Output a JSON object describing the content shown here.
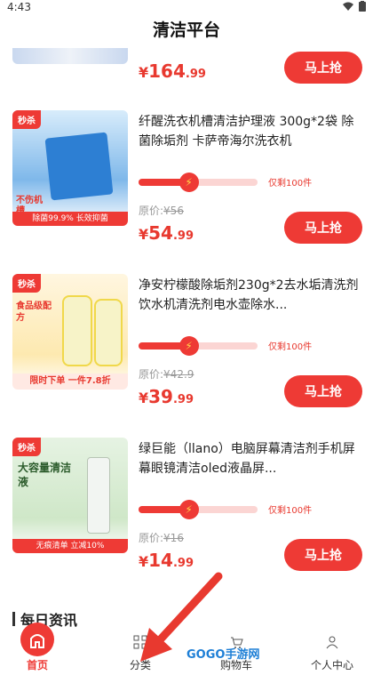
{
  "status_bar": {
    "time": "4:43"
  },
  "header": {
    "title": "清洁平台"
  },
  "top_item": {
    "price_yen": "¥",
    "price_int": "164",
    "price_dec": ".99",
    "buy_label": "马上抢"
  },
  "products": [
    {
      "tag": "秒杀",
      "title": "纤醒洗衣机槽清洁护理液 300g*2袋 除菌除垢剂 卡萨帝海尔洗衣机",
      "stock_text": "仅剩100件",
      "orig_label": "原价:",
      "orig_price": "¥56",
      "price_yen": "¥",
      "price_int": "54",
      "price_dec": ".99",
      "buy_label": "马上抢",
      "image_text_1": "不伤机槽",
      "image_text_2": "除菌99.9% 长效抑菌",
      "progress": 0.4
    },
    {
      "tag": "秒杀",
      "title": "净安柠檬酸除垢剂230g*2去水垢清洗剂饮水机清洗剂电水壶除水...",
      "stock_text": "仅剩100件",
      "orig_label": "原价:",
      "orig_price": "¥42.9",
      "price_yen": "¥",
      "price_int": "39",
      "price_dec": ".99",
      "buy_label": "马上抢",
      "image_text_1": "食品级配方",
      "image_text_2": "限时下单 一件7.8折",
      "progress": 0.4
    },
    {
      "tag": "秒杀",
      "title": "绿巨能（llano）电脑屏幕清洁剂手机屏幕眼镜清洁oled液晶屏...",
      "stock_text": "仅剩100件",
      "orig_label": "原价:",
      "orig_price": "¥16",
      "price_yen": "¥",
      "price_int": "14",
      "price_dec": ".99",
      "buy_label": "马上抢",
      "image_text_1": "大容量清洁液",
      "image_text_2": "无痕清单 立减10%",
      "progress": 0.4
    }
  ],
  "section": {
    "title": "每日资讯"
  },
  "tabbar": {
    "home": "首页",
    "category": "分类",
    "cart": "购物车",
    "profile": "个人中心"
  },
  "watermark": {
    "text": "GOGO手游网"
  },
  "colors": {
    "accent": "#ee3a35",
    "track": "#fbd5d3"
  }
}
